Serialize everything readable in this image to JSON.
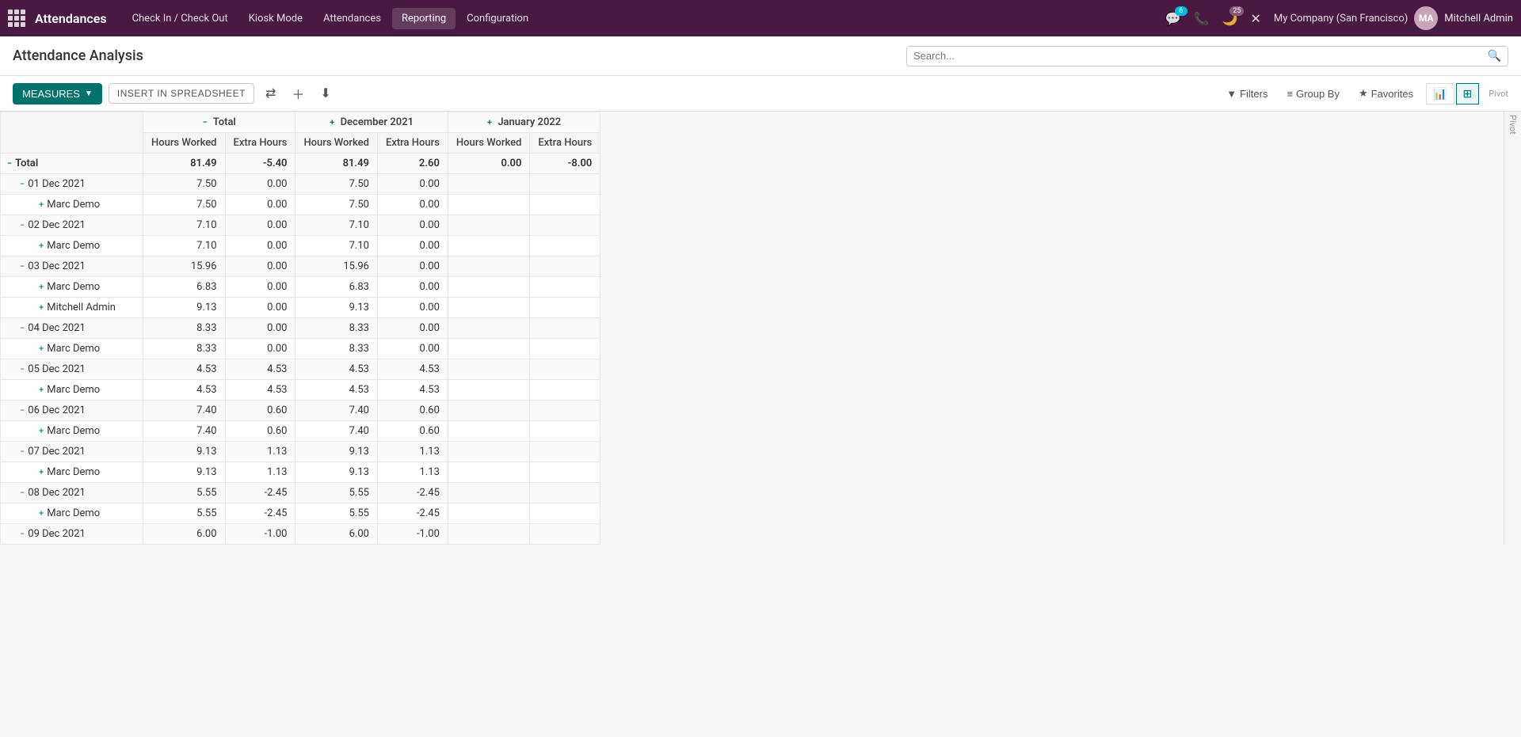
{
  "app": {
    "title": "Attendances",
    "grid_icon_label": "apps"
  },
  "nav": {
    "items": [
      {
        "id": "check-in-out",
        "label": "Check In / Check Out"
      },
      {
        "id": "kiosk-mode",
        "label": "Kiosk Mode"
      },
      {
        "id": "attendances",
        "label": "Attendances"
      },
      {
        "id": "reporting",
        "label": "Reporting"
      },
      {
        "id": "configuration",
        "label": "Configuration"
      }
    ]
  },
  "topnav_right": {
    "chat_badge": "6",
    "phone_icon": "phone",
    "moon_badge": "25",
    "close_icon": "x",
    "company": "My Company (San Francisco)",
    "username": "Mitchell Admin"
  },
  "page": {
    "title": "Attendance Analysis"
  },
  "search": {
    "placeholder": "Search..."
  },
  "toolbar": {
    "measures_label": "MEASURES",
    "insert_label": "INSERT IN SPREADSHEET",
    "filter_label": "Filters",
    "group_by_label": "Group By",
    "favorites_label": "Favorites",
    "pivot_label": "Pivot"
  },
  "table": {
    "columns": {
      "total": "Total",
      "dec2021": "December 2021",
      "jan2022": "January 2022",
      "hours_worked": "Hours Worked",
      "extra_hours": "Extra Hours"
    },
    "rows": [
      {
        "type": "total",
        "label": "Total",
        "indent": 0,
        "expand": "minus",
        "dec_hours": "81.49",
        "dec_extra": "2.60",
        "jan_hours": "0.00",
        "jan_extra": "-8.00",
        "total_hours": "81.49",
        "total_extra": "-5.40"
      },
      {
        "type": "date",
        "label": "01 Dec 2021",
        "indent": 1,
        "expand": "minus",
        "dec_hours": "7.50",
        "dec_extra": "0.00",
        "jan_hours": "",
        "jan_extra": "",
        "total_hours": "7.50",
        "total_extra": "0.00"
      },
      {
        "type": "person",
        "label": "Marc Demo",
        "indent": 2,
        "expand": "plus",
        "dec_hours": "7.50",
        "dec_extra": "0.00",
        "jan_hours": "",
        "jan_extra": "",
        "total_hours": "7.50",
        "total_extra": "0.00"
      },
      {
        "type": "date",
        "label": "02 Dec 2021",
        "indent": 1,
        "expand": "minus",
        "dec_hours": "7.10",
        "dec_extra": "0.00",
        "jan_hours": "",
        "jan_extra": "",
        "total_hours": "7.10",
        "total_extra": "0.00"
      },
      {
        "type": "person",
        "label": "Marc Demo",
        "indent": 2,
        "expand": "plus",
        "dec_hours": "7.10",
        "dec_extra": "0.00",
        "jan_hours": "",
        "jan_extra": "",
        "total_hours": "7.10",
        "total_extra": "0.00"
      },
      {
        "type": "date",
        "label": "03 Dec 2021",
        "indent": 1,
        "expand": "minus",
        "dec_hours": "15.96",
        "dec_extra": "0.00",
        "jan_hours": "",
        "jan_extra": "",
        "total_hours": "15.96",
        "total_extra": "0.00"
      },
      {
        "type": "person",
        "label": "Marc Demo",
        "indent": 2,
        "expand": "plus",
        "dec_hours": "6.83",
        "dec_extra": "0.00",
        "jan_hours": "",
        "jan_extra": "",
        "total_hours": "6.83",
        "total_extra": "0.00"
      },
      {
        "type": "person",
        "label": "Mitchell Admin",
        "indent": 2,
        "expand": "plus",
        "dec_hours": "9.13",
        "dec_extra": "0.00",
        "jan_hours": "",
        "jan_extra": "",
        "total_hours": "9.13",
        "total_extra": "0.00"
      },
      {
        "type": "date",
        "label": "04 Dec 2021",
        "indent": 1,
        "expand": "minus",
        "dec_hours": "8.33",
        "dec_extra": "0.00",
        "jan_hours": "",
        "jan_extra": "",
        "total_hours": "8.33",
        "total_extra": "0.00"
      },
      {
        "type": "person",
        "label": "Marc Demo",
        "indent": 2,
        "expand": "plus",
        "dec_hours": "8.33",
        "dec_extra": "0.00",
        "jan_hours": "",
        "jan_extra": "",
        "total_hours": "8.33",
        "total_extra": "0.00"
      },
      {
        "type": "date",
        "label": "05 Dec 2021",
        "indent": 1,
        "expand": "minus",
        "dec_hours": "4.53",
        "dec_extra": "4.53",
        "jan_hours": "",
        "jan_extra": "",
        "total_hours": "4.53",
        "total_extra": "4.53"
      },
      {
        "type": "person",
        "label": "Marc Demo",
        "indent": 2,
        "expand": "plus",
        "dec_hours": "4.53",
        "dec_extra": "4.53",
        "jan_hours": "",
        "jan_extra": "",
        "total_hours": "4.53",
        "total_extra": "4.53"
      },
      {
        "type": "date",
        "label": "06 Dec 2021",
        "indent": 1,
        "expand": "minus",
        "dec_hours": "7.40",
        "dec_extra": "0.60",
        "jan_hours": "",
        "jan_extra": "",
        "total_hours": "7.40",
        "total_extra": "0.60"
      },
      {
        "type": "person",
        "label": "Marc Demo",
        "indent": 2,
        "expand": "plus",
        "dec_hours": "7.40",
        "dec_extra": "0.60",
        "jan_hours": "",
        "jan_extra": "",
        "total_hours": "7.40",
        "total_extra": "0.60"
      },
      {
        "type": "date",
        "label": "07 Dec 2021",
        "indent": 1,
        "expand": "minus",
        "dec_hours": "9.13",
        "dec_extra": "1.13",
        "jan_hours": "",
        "jan_extra": "",
        "total_hours": "9.13",
        "total_extra": "1.13"
      },
      {
        "type": "person",
        "label": "Marc Demo",
        "indent": 2,
        "expand": "plus",
        "dec_hours": "9.13",
        "dec_extra": "1.13",
        "jan_hours": "",
        "jan_extra": "",
        "total_hours": "9.13",
        "total_extra": "1.13"
      },
      {
        "type": "date",
        "label": "08 Dec 2021",
        "indent": 1,
        "expand": "minus",
        "dec_hours": "5.55",
        "dec_extra": "-2.45",
        "jan_hours": "",
        "jan_extra": "",
        "total_hours": "5.55",
        "total_extra": "-2.45"
      },
      {
        "type": "person",
        "label": "Marc Demo",
        "indent": 2,
        "expand": "plus",
        "dec_hours": "5.55",
        "dec_extra": "-2.45",
        "jan_hours": "",
        "jan_extra": "",
        "total_hours": "5.55",
        "total_extra": "-2.45"
      },
      {
        "type": "date",
        "label": "09 Dec 2021",
        "indent": 1,
        "expand": "minus",
        "dec_hours": "6.00",
        "dec_extra": "-1.00",
        "jan_hours": "",
        "jan_extra": "",
        "total_hours": "6.00",
        "total_extra": "-1.00"
      }
    ]
  }
}
